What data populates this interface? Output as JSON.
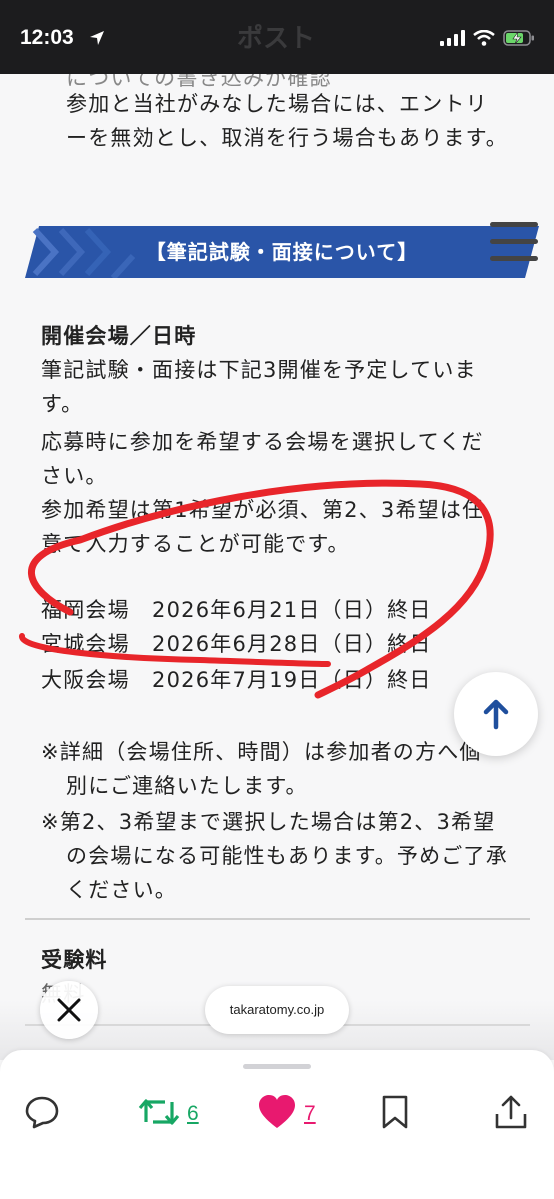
{
  "status_bar": {
    "time": "12:03"
  },
  "header": {
    "title": "ポスト"
  },
  "article": {
    "intro_fragment": "についての書き込みが確認",
    "intro_lines": [
      "参加と当社がみなした場合には、エントリ",
      "ーを無効とし、取消を行う場合もあります。"
    ],
    "banner": "【筆記試験・面接について】",
    "section_heading": "開催会場／日時",
    "paragraph_lines": [
      "筆記試験・面接は下記3開催を予定していま",
      "す。",
      "応募時に参加を希望する会場を選択してくだ",
      "さい。",
      "参加希望は第1希望が必須、第2、3希望は任",
      "意で入力することが可能です。"
    ],
    "venues": [
      {
        "name": "福岡会場",
        "date": "2026年6月21日（日）終日"
      },
      {
        "name": "宮城会場",
        "date": "2026年6月28日（日）終日"
      },
      {
        "name": "大阪会場",
        "date": "2026年7月19日（日）終日"
      }
    ],
    "notes_lines": [
      "※詳細（会場住所、時間）は参加者の方へ個",
      "別にご連絡いたします。",
      "※第2、3希望まで選択した場合は第2、3希望",
      "の会場になる可能性もあります。予めご了承",
      "ください。"
    ],
    "fee_heading": "受験料",
    "fee_fragment": "無料"
  },
  "overlay": {
    "link": "takaratomy.co.jp"
  },
  "actions": {
    "retweet_count": "6",
    "like_count": "7"
  },
  "colors": {
    "banner": "#2a55a8",
    "annotation": "#e8252a",
    "retweet": "#17a764",
    "like": "#e8196f",
    "arrow": "#1f4f9d"
  }
}
